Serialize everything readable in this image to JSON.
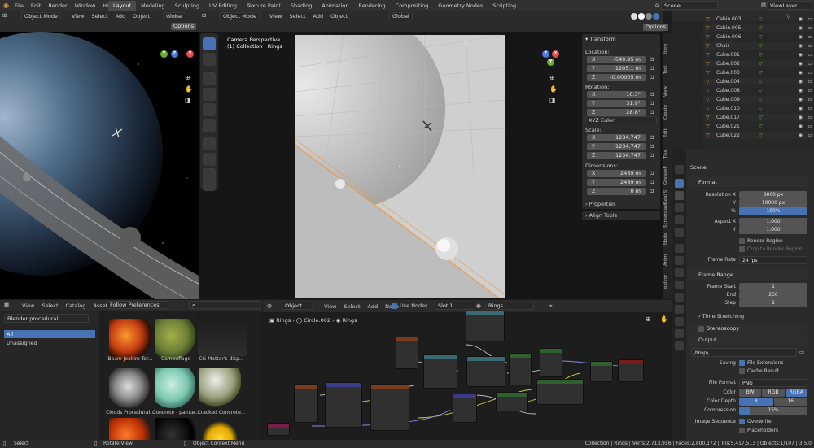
{
  "menu": [
    "File",
    "Edit",
    "Render",
    "Window",
    "Help"
  ],
  "workspaces": [
    "Layout",
    "Modeling",
    "Sculpting",
    "UV Editing",
    "Texture Paint",
    "Shading",
    "Animation",
    "Rendering",
    "Compositing",
    "Geometry Nodes",
    "Scripting"
  ],
  "active_workspace": "Layout",
  "scene_name": "Scene",
  "view_layer": "ViewLayer",
  "vp1": {
    "mode": "Object Mode",
    "menus": [
      "View",
      "Select",
      "Add",
      "Object"
    ],
    "orientation": "Global",
    "options": "Options"
  },
  "vp2": {
    "mode": "Object Mode",
    "menus": [
      "View",
      "Select",
      "Add",
      "Object"
    ],
    "orientation": "Global",
    "options": "Options",
    "camera_title": "Camera Perspective",
    "collection_label": "(1) Collection | Rings"
  },
  "transform": {
    "title": "Transform",
    "location_label": "Location:",
    "location": [
      {
        "axis": "X",
        "value": "-540.95 m"
      },
      {
        "axis": "Y",
        "value": "1205.1 m"
      },
      {
        "axis": "Z",
        "value": "-0.00005 m"
      }
    ],
    "rotation_label": "Rotation:",
    "rotation": [
      {
        "axis": "X",
        "value": "10.3°"
      },
      {
        "axis": "Y",
        "value": "31.9°"
      },
      {
        "axis": "Z",
        "value": "28.8°"
      }
    ],
    "rot_mode": "XYZ Euler",
    "scale_label": "Scale:",
    "scale": [
      {
        "axis": "X",
        "value": "1234.747"
      },
      {
        "axis": "Y",
        "value": "1234.747"
      },
      {
        "axis": "Z",
        "value": "1234.747"
      }
    ],
    "dimensions_label": "Dimensions:",
    "dimensions": [
      {
        "axis": "X",
        "value": "2469 m"
      },
      {
        "axis": "Y",
        "value": "2469 m"
      },
      {
        "axis": "Z",
        "value": "0 m"
      }
    ],
    "properties": "Properties",
    "align_tools": "Align Tools"
  },
  "sidebar_tabs": [
    "Item",
    "Tool",
    "View",
    "Create",
    "Edit",
    "Tiss",
    "GreaseP",
    "Real S",
    "Screencast",
    "Node",
    "Anim",
    "polygr"
  ],
  "outliner": [
    {
      "name": "Cabin.003"
    },
    {
      "name": "Cabin.005"
    },
    {
      "name": "Cabin.006"
    },
    {
      "name": "Chair"
    },
    {
      "name": "Cube.001"
    },
    {
      "name": "Cube.002"
    },
    {
      "name": "Cube.003"
    },
    {
      "name": "Cube.004"
    },
    {
      "name": "Cube.008"
    },
    {
      "name": "Cube.009"
    },
    {
      "name": "Cube.010"
    },
    {
      "name": "Cube.017"
    },
    {
      "name": "Cube.021"
    },
    {
      "name": "Cube.022"
    }
  ],
  "props": {
    "scene_label": "Scene",
    "format": "Format",
    "res_x_label": "Resolution X",
    "res_x": "8000 px",
    "res_y_label": "Y",
    "res_y": "10000 px",
    "pct_label": "%",
    "pct": "100%",
    "aspect_x_label": "Aspect X",
    "aspect_x": "1.000",
    "aspect_y_label": "Y",
    "aspect_y": "1.000",
    "render_region": "Render Region",
    "crop": "Crop to Render Region",
    "frame_rate_label": "Frame Rate",
    "frame_rate": "24 fps",
    "frame_range": "Frame Range",
    "frame_start_label": "Frame Start",
    "frame_start": "1",
    "end_label": "End",
    "end": "250",
    "step_label": "Step",
    "step": "1",
    "time_stretching": "Time Stretching",
    "stereoscopy": "Stereoscopy",
    "output": "Output",
    "output_path": "/tmp\\",
    "saving_label": "Saving",
    "file_ext": "File Extensions",
    "cache_result": "Cache Result",
    "file_format_label": "File Format",
    "file_format": "PNG",
    "color_label": "Color",
    "color_opts": [
      "BW",
      "RGB",
      "RGBA"
    ],
    "depth_label": "Color Depth",
    "depth_opts": [
      "8",
      "16"
    ],
    "compression_label": "Compression",
    "compression": "15%",
    "img_seq_label": "Image Sequence",
    "overwrite": "Overwrite",
    "placeholders": "Placeholders"
  },
  "asset_browser": {
    "menus": [
      "View",
      "Select",
      "Catalog",
      "Asset"
    ],
    "follow": "Follow Preferences",
    "library": "Blender procedural",
    "all": "All",
    "unassigned": "Unassigned",
    "items": [
      "Beam Joakim Tor...",
      "Camouflage",
      "CG Matter's disp...",
      "Clouds Procedural...",
      "Concrete - painte...",
      "Cracked Concrete..."
    ]
  },
  "node_editor": {
    "type": "Object",
    "menus": [
      "View",
      "Select",
      "Add",
      "Node"
    ],
    "use_nodes": "Use Nodes",
    "slot": "Slot 1",
    "material": "Rings",
    "breadcrumb": [
      "Rings",
      "Circle.002",
      "Rings"
    ]
  },
  "status": {
    "left": [
      "Select",
      "Rotate View",
      "Object Context Menu"
    ],
    "right": "Collection | Rings | Verts:2,713,916 | Faces:2,800,172 | Tris:5,417,513 | Objects:1/107 | 3.5.0"
  },
  "colors": {
    "accent": "#4772b3",
    "orange": "#e89b4a",
    "x_axis": "#e04b4b",
    "y_axis": "#6bae2a",
    "z_axis": "#4b7be0"
  }
}
